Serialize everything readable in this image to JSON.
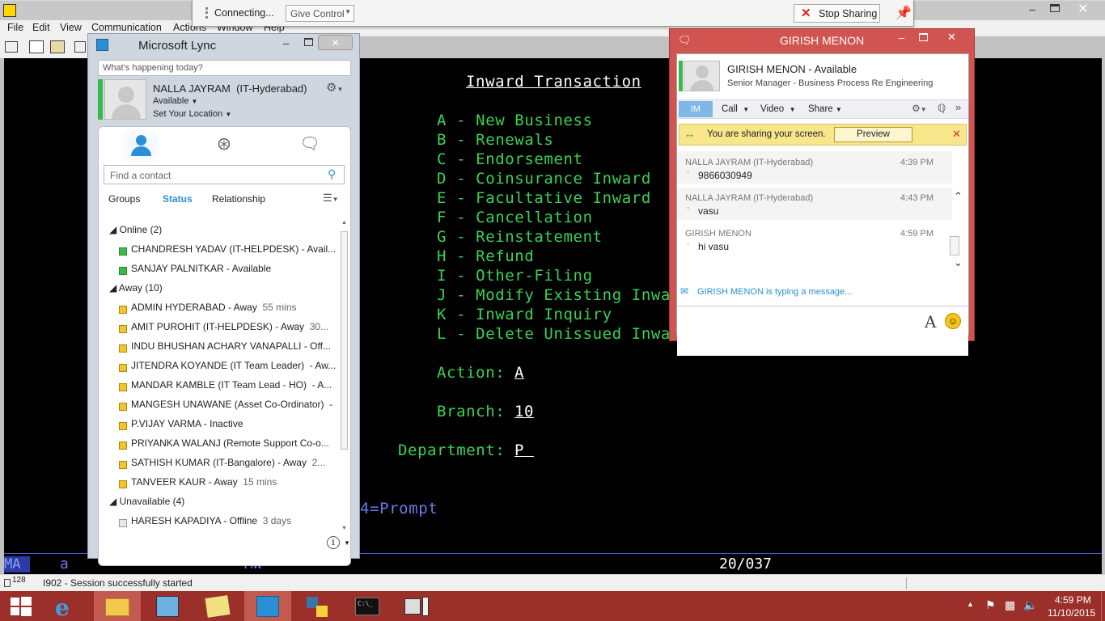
{
  "emulator": {
    "menu": [
      "File",
      "Edit",
      "View",
      "Communication",
      "Actions",
      "Window",
      "Help"
    ],
    "screen": {
      "title": "Inward Transaction",
      "options": [
        "A - New Business",
        "B - Renewals",
        "C - Endorsement",
        "D - Coinsurance Inward",
        "E - Facultative Inward",
        "F - Cancellation",
        "G - Reinstatement",
        "H - Refund",
        "I - Other-Filing",
        "J - Modify Existing Inwa",
        "K - Inward Inquiry",
        "L - Delete Unissued Inwa"
      ],
      "action_label": "Action:",
      "action_value": "A",
      "branch_label": "Branch:",
      "branch_value": "10",
      "department_label": "Department:",
      "department_value": "P",
      "prompt_hint": "4=Prompt"
    },
    "status_line": {
      "mode": "MA",
      "a": "a",
      "mw": "MW",
      "position": "20/037"
    },
    "status_bar": {
      "session_num": "128",
      "message": "I902 - Session successfully started"
    }
  },
  "share_bar": {
    "connecting": "Connecting...",
    "give_control": "Give Control",
    "stop_sharing": "Stop Sharing"
  },
  "lync": {
    "title": "Microsoft Lync",
    "whats_happening": "What's happening today?",
    "user_name": "NALLA JAYRAM  (IT-Hyderabad)",
    "availability": "Available",
    "location": "Set Your Location",
    "search_placeholder": "Find a contact",
    "tabs": [
      "Groups",
      "Status",
      "Relationship"
    ],
    "groups": {
      "online": "Online (2)",
      "away": "Away (10)",
      "unavailable": "Unavailable (4)"
    },
    "online": [
      {
        "name": "CHANDRESH YADAV (IT-HELPDESK) - Avail..."
      },
      {
        "name": "SANJAY PALNITKAR - Available"
      }
    ],
    "away": [
      {
        "name": "ADMIN HYDERABAD - Away",
        "time": "55 mins"
      },
      {
        "name": "AMIT PUROHIT (IT-HELPDESK) - Away",
        "time": "30..."
      },
      {
        "name": "INDU BHUSHAN ACHARY VANAPALLI - Off...",
        "time": ""
      },
      {
        "name": "JITENDRA KOYANDE (IT Team Leader)  - Aw...",
        "time": ""
      },
      {
        "name": "MANDAR KAMBLE (IT Team Lead - HO)  - A...",
        "time": ""
      },
      {
        "name": "MANGESH UNAWANE (Asset Co-Ordinator)  -",
        "time": ""
      },
      {
        "name": "P.VIJAY VARMA - Inactive",
        "time": ""
      },
      {
        "name": "PRIYANKA WALANJ (Remote Support Co-o...",
        "time": ""
      },
      {
        "name": "SATHISH KUMAR (IT-Bangalore) - Away",
        "time": "2..."
      },
      {
        "name": "TANVEER KAUR - Away",
        "time": "15 mins"
      }
    ],
    "unavailable": [
      {
        "name": "HARESH KAPADIYA - Offline",
        "time": "3 days"
      }
    ]
  },
  "conversation": {
    "title": "GIRISH MENON",
    "contact_status": "GIRISH MENON - Available",
    "contact_role": "Senior Manager - Business Process Re Engineering",
    "toolbar": [
      "IM",
      "Call",
      "Video",
      "Share"
    ],
    "sharing_notice": "You are sharing your screen.",
    "preview": "Preview",
    "messages": [
      {
        "sender": "NALLA JAYRAM (IT-Hyderabad)",
        "time": "4:39 PM",
        "text": "9866030949"
      },
      {
        "sender": "NALLA JAYRAM (IT-Hyderabad)",
        "time": "4:43 PM",
        "text": "vasu"
      },
      {
        "sender": "GIRISH MENON",
        "time": "4:59 PM",
        "text": "hi vasu"
      }
    ],
    "typing": "GIRISH MENON is typing a message..."
  },
  "taskbar": {
    "time": "4:59 PM",
    "date": "11/10/2015"
  },
  "colors": {
    "terminal_green": "#39d353",
    "lync_accent": "#2a8fd4",
    "conv_frame": "#d25450",
    "taskbar": "#9b2f2a"
  }
}
